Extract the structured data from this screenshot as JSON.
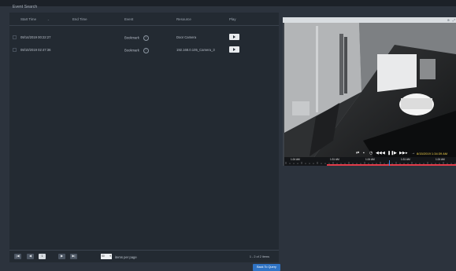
{
  "page": {
    "title": "Event Search"
  },
  "table": {
    "columns": [
      "Start Time",
      "End Time",
      "Event",
      "Resource",
      "Play"
    ],
    "sort_indicator": "⌄",
    "rows": [
      {
        "start": "08/14/2019 00:22:27",
        "end": "",
        "event": "Bookmark",
        "resource": "Door Camera"
      },
      {
        "start": "08/10/2019 02:47:36",
        "end": "",
        "event": "Bookmark",
        "resource": "192.168.0.105_Camera_3"
      }
    ],
    "help_glyph": "?"
  },
  "pagination": {
    "first": "|◀",
    "prev": "◀",
    "page": "1",
    "of": "/1",
    "next": "▶",
    "last": "▶|",
    "per_page": "50",
    "per_page_label": "items per page",
    "range_text": "1 - 2 of 2 items"
  },
  "actions": {
    "back_to_query": "Back To Query"
  },
  "player": {
    "timestamp": "8/15/2019 1:34:39 AM",
    "timeline_labels": [
      "1:24 AM",
      "1:31 AM",
      "1:24 AM",
      "1:31 AM",
      "1:24 AM"
    ],
    "colors": {
      "timeline_red": "#e23b49",
      "cursor": "#3d89e6",
      "timestamp": "#f5d44b"
    }
  }
}
